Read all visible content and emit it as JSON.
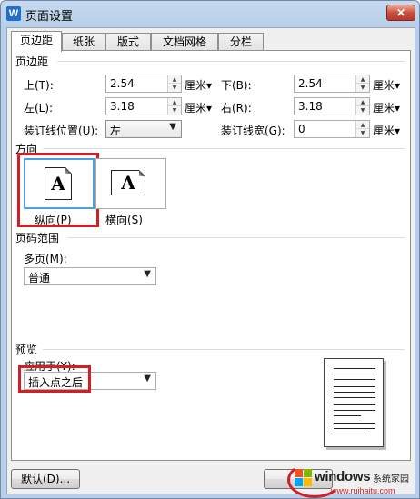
{
  "window": {
    "title": "页面设置",
    "app_icon_letter": "W",
    "close_glyph": "✕"
  },
  "tabs": [
    {
      "label": "页边距",
      "active": true
    },
    {
      "label": "纸张",
      "active": false
    },
    {
      "label": "版式",
      "active": false
    },
    {
      "label": "文档网格",
      "active": false
    },
    {
      "label": "分栏",
      "active": false
    }
  ],
  "margins": {
    "section_label": "页边距",
    "top": {
      "label": "上(T):",
      "value": "2.54",
      "unit": "厘米▾"
    },
    "bottom": {
      "label": "下(B):",
      "value": "2.54",
      "unit": "厘米▾"
    },
    "left": {
      "label": "左(L):",
      "value": "3.18",
      "unit": "厘米▾"
    },
    "right": {
      "label": "右(R):",
      "value": "3.18",
      "unit": "厘米▾"
    },
    "gutter_pos": {
      "label": "装订线位置(U):",
      "value": "左"
    },
    "gutter": {
      "label": "装订线宽(G):",
      "value": "0",
      "unit": "厘米▾"
    }
  },
  "orientation": {
    "section_label": "方向",
    "portrait": {
      "label": "纵向(P)",
      "glyph": "A",
      "selected": true
    },
    "landscape": {
      "label": "横向(S)",
      "glyph": "A",
      "selected": false
    }
  },
  "pages": {
    "section_label": "页码范围",
    "multi_label": "多页(M):",
    "multi_value": "普通"
  },
  "preview": {
    "section_label": "预览",
    "apply_label": "应用于(Y):",
    "apply_value": "插入点之后"
  },
  "buttons": {
    "default": "默认(D)..."
  },
  "watermark": {
    "brand": "windows",
    "suffix": "系统家园",
    "url": "www.ruihaitu.com"
  },
  "colors": {
    "highlight_red": "#d21f26",
    "selection_blue": "#4d9ee8"
  }
}
